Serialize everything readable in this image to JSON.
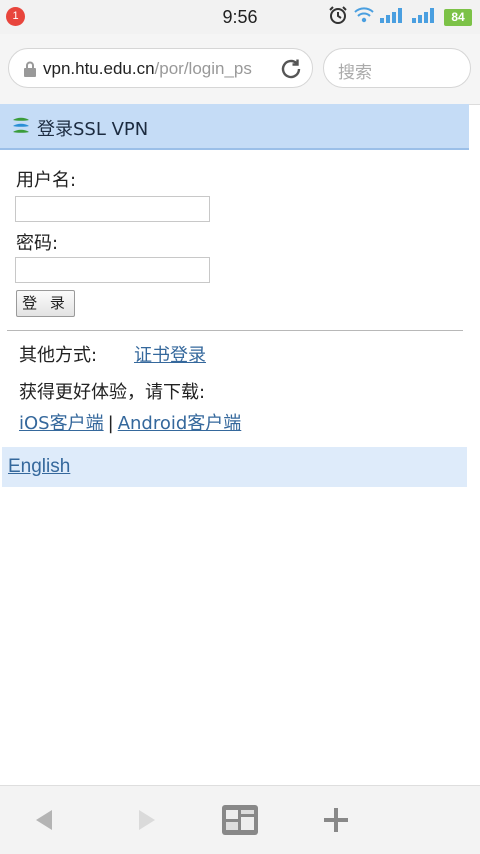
{
  "status_bar": {
    "notification_count": "1",
    "time": "9:56",
    "battery": "84",
    "icons": [
      "alarm-icon",
      "wifi-icon",
      "signal-icon",
      "signal-icon",
      "battery-icon"
    ]
  },
  "browser": {
    "url_host": "vpn.htu.edu.cn",
    "url_path": "/por/login_ps",
    "search_placeholder": "搜索"
  },
  "header": {
    "title": "登录SSL VPN"
  },
  "form": {
    "username_label": "用户名:",
    "username_value": "",
    "password_label": "密码:",
    "password_value": "",
    "login_button": "登 录"
  },
  "other": {
    "label": "其他方式:",
    "cert_login": "证书登录",
    "download_text": "获得更好体验，请下载:",
    "ios_client": "iOS客户端",
    "separator": "|",
    "android_client": "Android客户端"
  },
  "footer": {
    "language_link": "English"
  },
  "bottom_bar": {
    "buttons": [
      "back-icon",
      "forward-icon",
      "tabs-icon",
      "new-tab-icon"
    ]
  },
  "colors": {
    "header_bg": "#c5dcf6",
    "link": "#35689c",
    "footer_bg": "#deebfa"
  }
}
